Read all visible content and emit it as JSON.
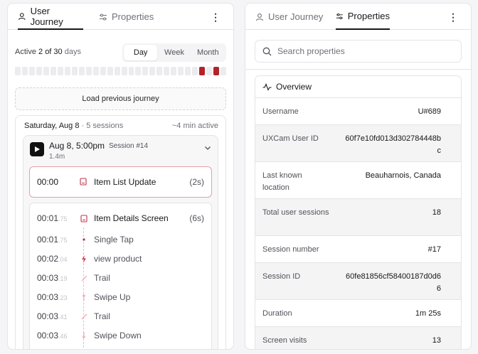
{
  "left": {
    "tabs": [
      {
        "label": "User Journey",
        "active": true
      },
      {
        "label": "Properties",
        "active": false
      }
    ],
    "active": {
      "prefix": "Active ",
      "count": "2 of 30",
      "suffix": " days"
    },
    "range": [
      "Day",
      "Week",
      "Month"
    ],
    "selected_range": "Day",
    "load_label": "Load previous journey",
    "day": {
      "date": "Saturday, Aug 8",
      "sessions": " · 5 sessions",
      "duration": "~4 min active"
    },
    "session": {
      "time": "Aug 8, 5:00pm",
      "number": "Session #14",
      "length": "1.4m"
    },
    "highlight_event": {
      "time": "00:00",
      "label": "Item List Update",
      "duration": "(2s)"
    },
    "screen_event": {
      "time": "00:01",
      "ms": ".75",
      "label": "Item Details Screen",
      "duration": "(6s)"
    },
    "events": [
      {
        "time": "00:01",
        "ms": ".75",
        "label": "Single Tap",
        "icon": "dot-icon"
      },
      {
        "time": "00:02",
        "ms": ".04",
        "label": "view product",
        "icon": "bolt-icon"
      },
      {
        "time": "00:03",
        "ms": ".19",
        "label": "Trail",
        "icon": "trail-icon"
      },
      {
        "time": "00:03",
        "ms": ".23",
        "label": "Swipe Up",
        "icon": "arrow-up-icon"
      },
      {
        "time": "00:03",
        "ms": ".41",
        "label": "Trail",
        "icon": "trail-icon"
      },
      {
        "time": "00:03",
        "ms": ".46",
        "label": "Swipe Down",
        "icon": "arrow-down-icon"
      }
    ]
  },
  "right": {
    "tabs": [
      {
        "label": "User Journey",
        "active": false
      },
      {
        "label": "Properties",
        "active": true
      }
    ],
    "search_placeholder": "Search properties",
    "overview_title": "Overview",
    "properties": [
      {
        "key": "Username",
        "value": "U#689"
      },
      {
        "key": "UXCam User ID",
        "value": "60f7e10fd013d302784448bc"
      },
      {
        "key": "Last known location",
        "value": "Beauharnois, Canada"
      },
      {
        "key": "Total user sessions",
        "value": "18"
      },
      {
        "key": "Session number",
        "value": "#17"
      },
      {
        "key": "Session ID",
        "value": "60fe81856cf58400187d0d66"
      },
      {
        "key": "Duration",
        "value": "1m 25s"
      },
      {
        "key": "Screen visits",
        "value": "13"
      }
    ]
  },
  "colors": {
    "accent": "#b4232a",
    "highlight_border": "#e6a0a6"
  },
  "activity_days": {
    "total": 30,
    "active_indices": [
      26,
      28
    ]
  }
}
